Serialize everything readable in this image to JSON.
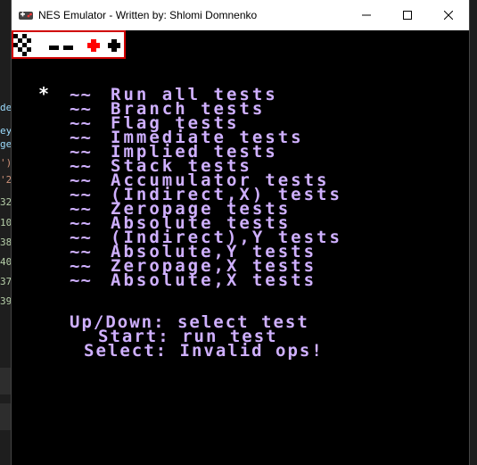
{
  "background_editor": {
    "fragments": [
      "de",
      "ey",
      "ge",
      "')",
      "'2",
      "32",
      "10",
      "38",
      "40",
      "37",
      "39"
    ],
    "colors": {
      "text": "#9cdcfe",
      "number": "#b5cea8",
      "string": "#ce9178"
    }
  },
  "window": {
    "title": "NES Emulator - Written by: Shlomi Domnenko",
    "app_icon": "nes-controller-icon",
    "controls": [
      "minimize-icon",
      "maximize-icon",
      "close-icon"
    ]
  },
  "controller": {
    "buttons": [
      "dpad-icon",
      "select-button-icon",
      "start-button-icon",
      "b-button-icon",
      "a-button-icon"
    ],
    "border_color": "#d00000",
    "a_button_color": "#ff0000"
  },
  "screen": {
    "text_color": "#cfb0ff",
    "cursor": "*",
    "menu_dash": "~~",
    "menu_items": [
      "Run all tests",
      "Branch tests",
      "Flag tests",
      "Immediate tests",
      "Implied tests",
      "Stack tests",
      "Accumulator tests",
      "(Indirect,X) tests",
      "Zeropage tests",
      "Absolute tests",
      "(Indirect),Y tests",
      "Absolute,Y tests",
      "Zeropage,X tests",
      "Absolute,X tests"
    ],
    "selected_index": 0,
    "help": {
      "line1": "Up/Down: select test",
      "line2": "Start: run test",
      "line3": "Select: Invalid ops!"
    }
  }
}
